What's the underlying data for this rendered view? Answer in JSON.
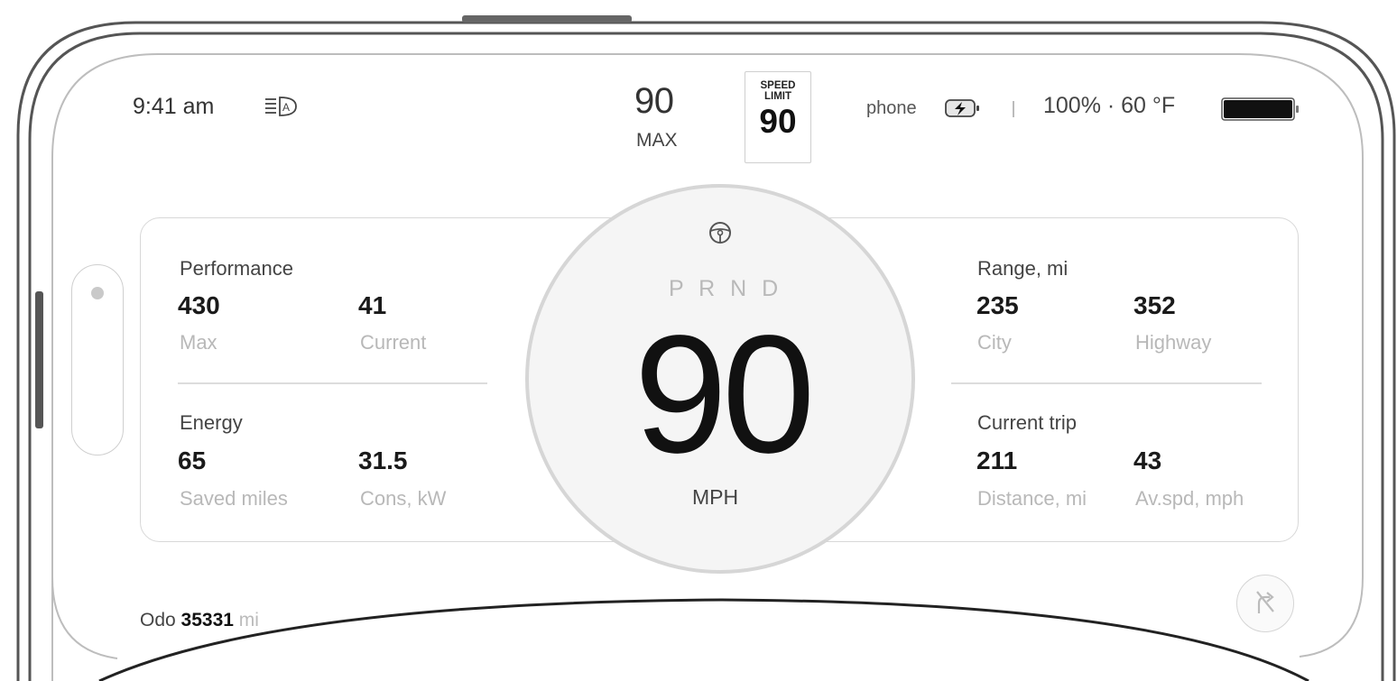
{
  "status": {
    "time": "9:41 am",
    "auto_headlights_icon": "auto-headlight-icon",
    "max_speed_value": "90",
    "max_speed_label": "MAX",
    "speed_limit_title_line1": "SPEED",
    "speed_limit_title_line2": "LIMIT",
    "speed_limit_value": "90",
    "phone_label": "phone",
    "phone_battery_icon": "charging-battery-icon",
    "battery_and_temp": "100% · 60 °F",
    "car_battery_level": 1.0
  },
  "performance": {
    "title": "Performance",
    "items": [
      {
        "value": "430",
        "label": "Max"
      },
      {
        "value": "41",
        "label": "Current"
      }
    ]
  },
  "energy": {
    "title": "Energy",
    "items": [
      {
        "value": "65",
        "label": "Saved miles"
      },
      {
        "value": "31.5",
        "label": "Cons, kW"
      }
    ]
  },
  "range": {
    "title": "Range, mi",
    "items": [
      {
        "value": "235",
        "label": "City"
      },
      {
        "value": "352",
        "label": "Highway"
      }
    ]
  },
  "trip": {
    "title": "Current trip",
    "items": [
      {
        "value": "211",
        "label": "Distance, mi"
      },
      {
        "value": "43",
        "label": "Av.spd, mph"
      }
    ]
  },
  "dial": {
    "gear": "P R N D",
    "speed": "90",
    "unit": "MPH"
  },
  "odometer": {
    "label": "Odo",
    "value": "35331",
    "unit": "mi"
  },
  "colors": {
    "frame": "#555555",
    "panel_border": "#d8d8d8",
    "dial_bg": "#f5f5f5",
    "muted_text": "#b8b8b8"
  }
}
